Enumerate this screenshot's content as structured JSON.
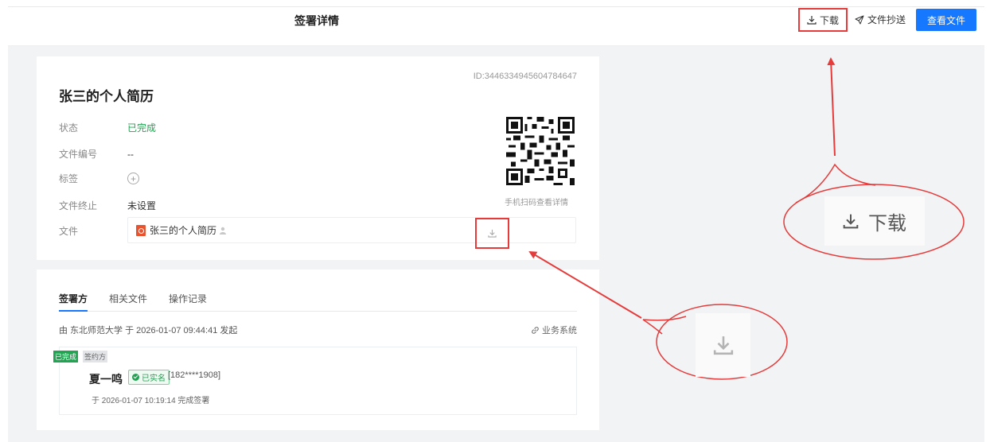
{
  "header": {
    "title": "签署详情",
    "download_label": "下载",
    "cc_label": "文件抄送",
    "view_file_label": "查看文件",
    "accent_color": "#1677ff"
  },
  "document": {
    "id_text": "ID:3446334945604784647",
    "title": "张三的个人简历",
    "fields": {
      "status_label": "状态",
      "status_value": "已完成",
      "number_label": "文件编号",
      "number_value": "--",
      "tags_label": "标签",
      "end_label": "文件终止",
      "end_value": "未设置",
      "file_label": "文件",
      "file_name": "张三的个人简历"
    },
    "qr_caption": "手机扫码查看详情",
    "status_color": "#22a352"
  },
  "signing": {
    "tabs": [
      "签署方",
      "相关文件",
      "操作记录"
    ],
    "initiator_text": "由 东北师范大学 于 2026-01-07 09:44:41 发起",
    "biz_system_label": "业务系统",
    "signer": {
      "status_tag": "已完成",
      "role_tag": "签约方",
      "name": "夏一鸣",
      "verified_label": "已实名",
      "phone": "[182****1908]",
      "signed_text": "于 2026-01-07 10:19:14 完成签署"
    }
  },
  "annotation": {
    "zoom_download_label": "下载",
    "highlight_color": "#e53b3b"
  }
}
